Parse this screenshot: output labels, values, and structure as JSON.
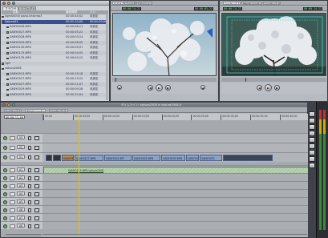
{
  "browser": {
    "tabs": [
      "ブラウザ",
      "エフェクト"
    ],
    "col_name": "名前",
    "col_duration": "継続時間",
    "col_in": "イン",
    "rows": [
      {
        "name": "SgmS0000 pano-intscmp3",
        "dur": "00:00:44;02",
        "in": "未設定"
      },
      {
        "name": "Sakura01",
        "dur": "00:01:10;00",
        "in": "00:01:00;00"
      },
      {
        "name": "SANY0026.MP4",
        "dur": "00:00:06;11",
        "in": "未設定"
      },
      {
        "name": "SANY0027.MP4",
        "dur": "00:00:05;22",
        "in": "未設定"
      },
      {
        "name": "SANY0028.MP4",
        "dur": "00:00:03;14",
        "in": "未設定"
      },
      {
        "name": "SANY0029.MP4",
        "dur": "00:00:06;05",
        "in": "未設定"
      },
      {
        "name": "SANY0130.MP4",
        "dur": "00:00:05;07",
        "in": "未設定"
      },
      {
        "name": "SANY0133.MP4",
        "dur": "00:00:04;05",
        "in": "未設定"
      },
      {
        "name": "SANY0135.MP4",
        "dur": "00:00:04;12",
        "in": "未設定"
      },
      {
        "name": "Tgff",
        "dur": "",
        "in": ""
      },
      {
        "name": "sakura2008",
        "dur": "",
        "in": ""
      },
      {
        "name": "SANY0015.MP4",
        "dur": "00:00:15;18",
        "in": "未設定"
      },
      {
        "name": "SANY0017.MP4",
        "dur": "00:00:13;12",
        "in": "未設定"
      },
      {
        "name": "SANY0027.MP4",
        "dur": "00:00:11;07",
        "in": "未設定"
      },
      {
        "name": "SANY0029.MP4",
        "dur": "00:00:09;28",
        "in": "未設定"
      },
      {
        "name": "SANY0033.MP4",
        "dur": "00:00:10;04",
        "in": "未設定"
      }
    ],
    "selected_index": 1
  },
  "viewer": {
    "title": "ビューア",
    "timecode_left": "00:00:14;22",
    "timecode_right": "00:00:05;22",
    "tabs": [
      "ビデオ",
      "フィルタ",
      "モーション"
    ]
  },
  "canvas": {
    "title": "キャンバス: sakura2008 in sakura2008-4",
    "timecode_left": "00:00:14;22",
    "timecode_right": "00:00:14;22",
    "tabs": [
      "シーケンス 1",
      "Whole シーケンス",
      "シーケンス 3"
    ]
  },
  "timeline": {
    "title": "タイムライン: sakura2008 in sakura2008-4",
    "tabs": [
      "シーケンス 1",
      "Whole シーケンス",
      "シーケンス 3"
    ],
    "timecode": "00:00:11;00",
    "ruler_marks": [
      "00:00",
      "00:00:05;00",
      "00:00:10;00",
      "00:00:15;00",
      "00:00:20;00",
      "00:00:25;00",
      "00:00:30;00",
      "00:00:35;00",
      "00:00:40;00"
    ],
    "video_tracks": [
      "V3",
      "V2",
      "V1"
    ],
    "audio_tracks": [
      "A1",
      "A2",
      "A3",
      "A4",
      "A5",
      "A6",
      "A7",
      "A8"
    ],
    "video_clips": [
      "",
      "",
      "SANY0126",
      "SANY0127.MP4",
      "SANY0020.MP",
      "SANY0029.MP4",
      "SANY0030.MP4",
      "SANY003",
      "SANY0032"
    ],
    "audio_clip_label": "SANY0125.MP4 sakura2008"
  },
  "colors": {
    "accent": "#3a4f8f",
    "timecode_text": "#9ef59e",
    "video_clip": "#8aa2c8",
    "audio_clip": "#a9c7a4",
    "playhead": "#e6c200"
  }
}
